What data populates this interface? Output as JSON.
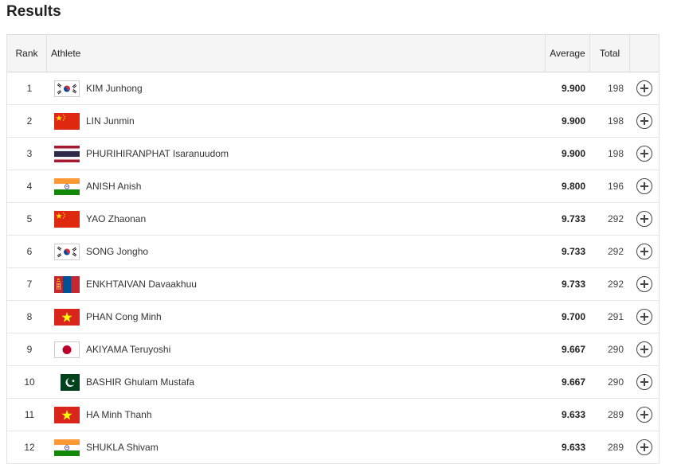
{
  "page": {
    "title": "Results"
  },
  "columns": {
    "rank": "Rank",
    "athlete": "Athlete",
    "average": "Average",
    "total": "Total"
  },
  "rows": [
    {
      "rank": "1",
      "athlete": "KIM Junhong",
      "flag": "kor",
      "average": "9.900",
      "total": "198"
    },
    {
      "rank": "2",
      "athlete": "LIN Junmin",
      "flag": "chn",
      "average": "9.900",
      "total": "198"
    },
    {
      "rank": "3",
      "athlete": "PHURIHIRANPHAT Isaranuudom",
      "flag": "tha",
      "average": "9.900",
      "total": "198"
    },
    {
      "rank": "4",
      "athlete": "ANISH Anish",
      "flag": "ind",
      "average": "9.800",
      "total": "196"
    },
    {
      "rank": "5",
      "athlete": "YAO Zhaonan",
      "flag": "chn",
      "average": "9.733",
      "total": "292"
    },
    {
      "rank": "6",
      "athlete": "SONG Jongho",
      "flag": "kor",
      "average": "9.733",
      "total": "292"
    },
    {
      "rank": "7",
      "athlete": "ENKHTAIVAN Davaakhuu",
      "flag": "mgl",
      "average": "9.733",
      "total": "292"
    },
    {
      "rank": "8",
      "athlete": "PHAN Cong Minh",
      "flag": "vie",
      "average": "9.700",
      "total": "291"
    },
    {
      "rank": "9",
      "athlete": "AKIYAMA Teruyoshi",
      "flag": "jpn",
      "average": "9.667",
      "total": "290"
    },
    {
      "rank": "10",
      "athlete": "BASHIR Ghulam Mustafa",
      "flag": "pak",
      "average": "9.667",
      "total": "290"
    },
    {
      "rank": "11",
      "athlete": "HA Minh Thanh",
      "flag": "vie",
      "average": "9.633",
      "total": "289"
    },
    {
      "rank": "12",
      "athlete": "SHUKLA Shivam",
      "flag": "ind",
      "average": "9.633",
      "total": "289"
    }
  ],
  "colors": {
    "header_bg": "#f5f5f5",
    "row_border": "#e6e6e6",
    "text": "#333333"
  }
}
